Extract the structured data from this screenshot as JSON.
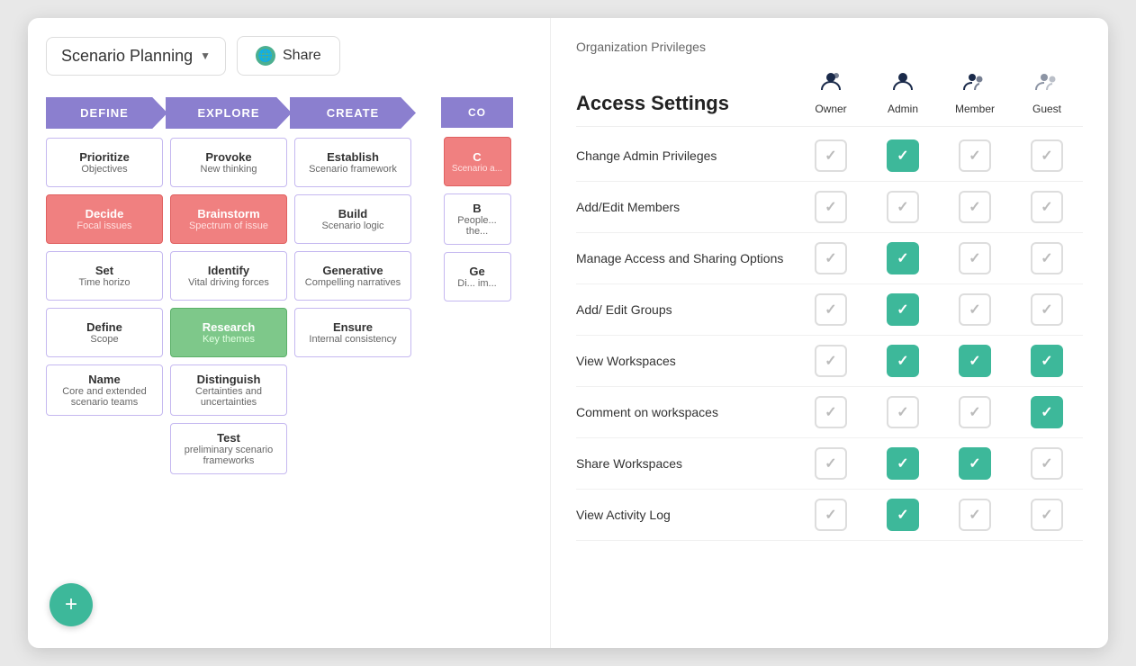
{
  "app": {
    "title": "Scenario Planning"
  },
  "topbar": {
    "scenario_label": "Scenario Planning",
    "dropdown_arrow": "▼",
    "share_label": "Share"
  },
  "pipeline": {
    "columns": [
      {
        "header": "DEFINE",
        "cards": [
          {
            "title": "Prioritize",
            "subtitle": "Objectives",
            "style": "normal"
          },
          {
            "title": "Decide",
            "subtitle": "Focal issues",
            "style": "red"
          },
          {
            "title": "Set",
            "subtitle": "Time horizo",
            "style": "normal"
          },
          {
            "title": "Define",
            "subtitle": "Scope",
            "style": "normal"
          },
          {
            "title": "Name",
            "subtitle": "Core and extended scenario teams",
            "style": "normal"
          }
        ]
      },
      {
        "header": "EXPLORE",
        "cards": [
          {
            "title": "Provoke",
            "subtitle": "New thinking",
            "style": "normal"
          },
          {
            "title": "Brainstorm",
            "subtitle": "Spectrum of issue",
            "style": "red"
          },
          {
            "title": "Identify",
            "subtitle": "Vital driving forces",
            "style": "normal"
          },
          {
            "title": "Research",
            "subtitle": "Key themes",
            "style": "green"
          },
          {
            "title": "Distinguish",
            "subtitle": "Certainties and uncertainties",
            "style": "normal"
          },
          {
            "title": "Test",
            "subtitle": "preliminary scenario frameworks",
            "style": "normal"
          }
        ]
      },
      {
        "header": "CREATE",
        "cards": [
          {
            "title": "Establish",
            "subtitle": "Scenario framework",
            "style": "normal"
          },
          {
            "title": "Build",
            "subtitle": "Scenario logic",
            "style": "normal"
          },
          {
            "title": "Generative",
            "subtitle": "Compelling narratives",
            "style": "normal"
          },
          {
            "title": "Ensure",
            "subtitle": "Internal consistency",
            "style": "normal"
          }
        ]
      },
      {
        "header": "CO",
        "cards": [
          {
            "title": "C",
            "subtitle": "Scenario a...",
            "style": "partial-red"
          },
          {
            "title": "B",
            "subtitle": "People... the...",
            "style": "normal"
          },
          {
            "title": "Ge",
            "subtitle": "Di... im...",
            "style": "normal"
          }
        ]
      }
    ]
  },
  "right_panel": {
    "org_privileges_title": "Organization Privileges",
    "access_settings_title": "Access Settings",
    "roles": [
      {
        "label": "Owner",
        "icon": "owner"
      },
      {
        "label": "Admin",
        "icon": "admin"
      },
      {
        "label": "Member",
        "icon": "member"
      },
      {
        "label": "Guest",
        "icon": "guest"
      }
    ],
    "permissions": [
      {
        "label": "Change Admin Privileges",
        "checks": [
          false,
          true,
          false,
          false
        ]
      },
      {
        "label": "Add/Edit Members",
        "checks": [
          false,
          false,
          false,
          false
        ]
      },
      {
        "label": "Manage Access and Sharing Options",
        "checks": [
          false,
          true,
          false,
          false
        ]
      },
      {
        "label": "Add/ Edit Groups",
        "checks": [
          false,
          true,
          false,
          false
        ]
      },
      {
        "label": "View Workspaces",
        "checks": [
          false,
          true,
          true,
          true
        ]
      },
      {
        "label": "Comment on workspaces",
        "checks": [
          false,
          false,
          false,
          true
        ]
      },
      {
        "label": "Share Workspaces",
        "checks": [
          false,
          true,
          true,
          false
        ]
      },
      {
        "label": "View Activity Log",
        "checks": [
          false,
          true,
          false,
          false
        ]
      }
    ]
  },
  "fab": {
    "label": "+"
  }
}
